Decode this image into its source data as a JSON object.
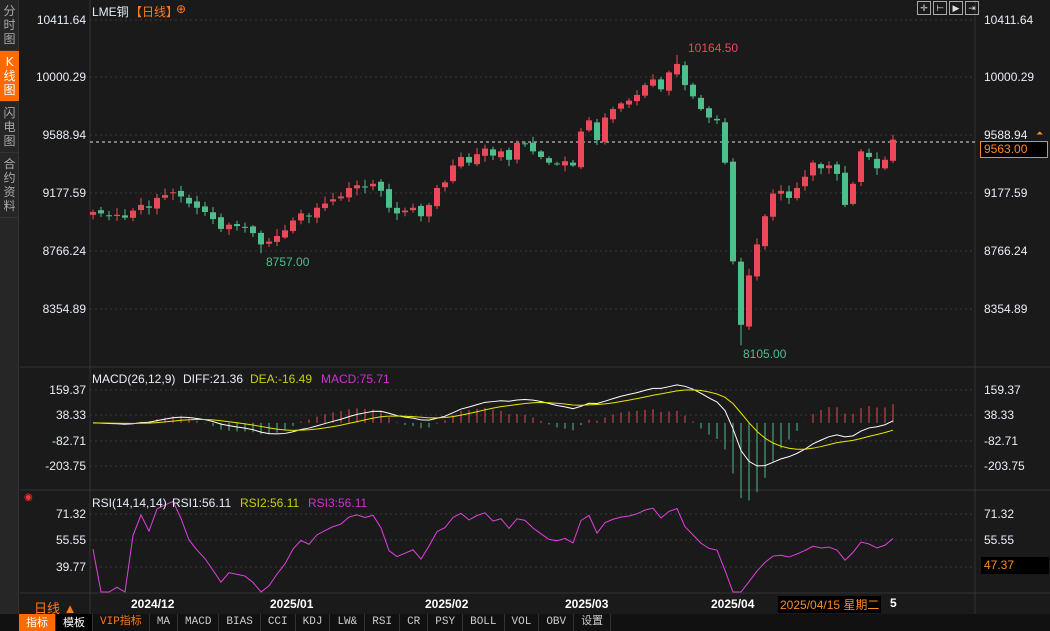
{
  "sidebar": {
    "items": [
      {
        "label": "分时图"
      },
      {
        "label": "K线图",
        "active": true
      },
      {
        "label": "闪电图"
      },
      {
        "label": "合约资料"
      }
    ]
  },
  "header": {
    "symbol": "LME铜",
    "period": "【日线】",
    "add_icon": "circle-plus-icon"
  },
  "tools": [
    "crosshair-icon",
    "range-icon",
    "play-icon",
    "exit-icon"
  ],
  "price_axis": {
    "left": [
      "10411.64",
      "10000.29",
      "9588.94",
      "9177.59",
      "8766.24",
      "8354.89"
    ],
    "right": [
      "10411.64",
      "10000.29",
      "9588.94",
      "9177.59",
      "8766.24",
      "8354.89"
    ],
    "current_price": "9563.00"
  },
  "annotations": {
    "high": "10164.50",
    "low1": "8757.00",
    "low2": "8105.00"
  },
  "macd": {
    "title": "MACD(26,12,9)",
    "diff": "DIFF:21.36",
    "dea": "DEA:-16.49",
    "macd": "MACD:75.71",
    "ticks": [
      "159.37",
      "38.33",
      "-82.71",
      "-203.75"
    ]
  },
  "rsi": {
    "title": "RSI(14,14,14)",
    "rsi1": "RSI1:56.11",
    "rsi2": "RSI2:56.11",
    "rsi3": "RSI3:56.11",
    "ticks": [
      "71.32",
      "55.55",
      "39.77"
    ],
    "cursor_value": "47.37"
  },
  "time_axis": {
    "period": "日线 ▲",
    "labels": [
      "2024/12",
      "2025/01",
      "2025/02",
      "2025/03",
      "2025/04"
    ],
    "cursor_date": "2025/04/15 星期二",
    "cursor_suffix": "5"
  },
  "toolbar": [
    "指标",
    "模板",
    "VIP指标",
    "MA",
    "MACD",
    "BIAS",
    "CCI",
    "KDJ",
    "LW&",
    "RSI",
    "CR",
    "PSY",
    "BOLL",
    "VOL",
    "OBV",
    "设置"
  ],
  "colors": {
    "up": "#e84b57",
    "down": "#4dbf8c",
    "accent": "#ff6a00",
    "diff": "#ffffff",
    "dea": "#e6e600",
    "rsi": "#e040e0"
  },
  "chart_data": {
    "type": "candlestick",
    "title": "LME铜 日线",
    "ylim": [
      8105,
      10411.64
    ],
    "closes": [
      9050,
      9040,
      9020,
      9030,
      9010,
      9060,
      9100,
      9080,
      9150,
      9170,
      9190,
      9160,
      9110,
      9080,
      9050,
      9000,
      8930,
      8960,
      8950,
      8940,
      8900,
      8820,
      8840,
      8880,
      8920,
      8990,
      9040,
      9020,
      9080,
      9110,
      9140,
      9160,
      9220,
      9240,
      9230,
      9250,
      9200,
      9080,
      9040,
      9060,
      9080,
      9020,
      9100,
      9220,
      9260,
      9380,
      9440,
      9400,
      9460,
      9500,
      9450,
      9480,
      9420,
      9540,
      9530,
      9480,
      9440,
      9400,
      9390,
      9410,
      9380,
      9620,
      9700,
      9560,
      9720,
      9780,
      9820,
      9840,
      9880,
      9950,
      9990,
      9920,
      10040,
      10100,
      9950,
      9870,
      9780,
      9720,
      9700,
      9400,
      8700,
      8250,
      8600,
      8820,
      9020,
      9180,
      9200,
      9150,
      9220,
      9300,
      9400,
      9360,
      9380,
      9320,
      9100,
      9250,
      9480,
      9440,
      9360,
      9420,
      9563
    ]
  }
}
